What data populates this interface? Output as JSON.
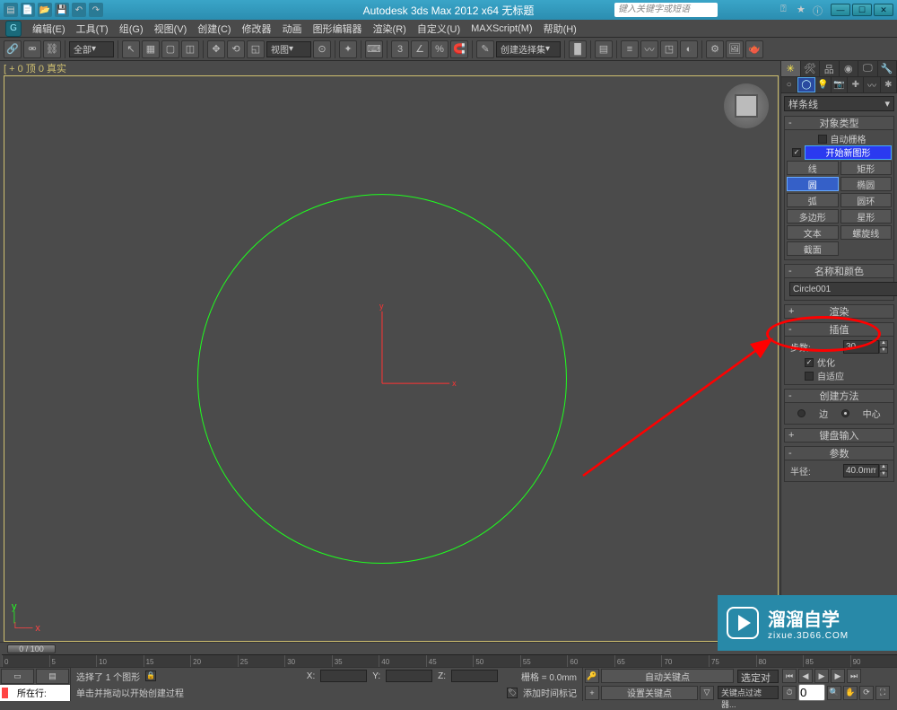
{
  "title": "Autodesk 3ds Max 2012 x64   无标题",
  "search_placeholder": "键入关键字或短语",
  "menus": [
    "编辑(E)",
    "工具(T)",
    "组(G)",
    "视图(V)",
    "创建(C)",
    "修改器",
    "动画",
    "图形编辑器",
    "渲染(R)",
    "自定义(U)",
    "MAXScript(M)",
    "帮助(H)"
  ],
  "toolbar": {
    "all": "全部",
    "view": "视图",
    "selectset": "创建选择集"
  },
  "vp_label": "[ + 0 顶 0 真实",
  "cmd": {
    "spline_dd": "样条线",
    "roll_objtype": "对象类型",
    "autogrid": "自动栅格",
    "startnew": "开始新图形",
    "shapes": [
      "线",
      "矩形",
      "圆",
      "椭圆",
      "弧",
      "圆环",
      "多边形",
      "星形",
      "文本",
      "螺旋线",
      "截面"
    ],
    "roll_name": "名称和颜色",
    "objname": "Circle001",
    "roll_render": "渲染",
    "roll_interp": "插值",
    "steps_lbl": "步数:",
    "steps_val": "30",
    "optimize": "优化",
    "adaptive": "自适应",
    "roll_create": "创建方法",
    "edge": "边",
    "center": "中心",
    "roll_kbd": "键盘输入",
    "roll_param": "参数",
    "radius_lbl": "半径:",
    "radius_val": "40.0mm"
  },
  "timeline": {
    "frame": "0 / 100",
    "ticks": [
      "0",
      "5",
      "10",
      "15",
      "20",
      "25",
      "30",
      "35",
      "40",
      "45",
      "50",
      "55",
      "60",
      "65",
      "70",
      "75",
      "80",
      "85",
      "90"
    ]
  },
  "status": {
    "sel": "选择了 1 个图形",
    "hint": "单击并拖动以开始创建过程",
    "addmark": "添加时间标记",
    "nowline": "所在行:",
    "x": "X:",
    "y": "Y:",
    "z": "Z:",
    "grid": "栅格 = 0.0mm",
    "autokey": "自动关键点",
    "selset2": "选定对象",
    "setkey": "设置关键点",
    "keyfilter": "关键点过滤器..."
  },
  "watermark": {
    "big": "溜溜自学",
    "sm": "zixue.3D66.COM"
  }
}
